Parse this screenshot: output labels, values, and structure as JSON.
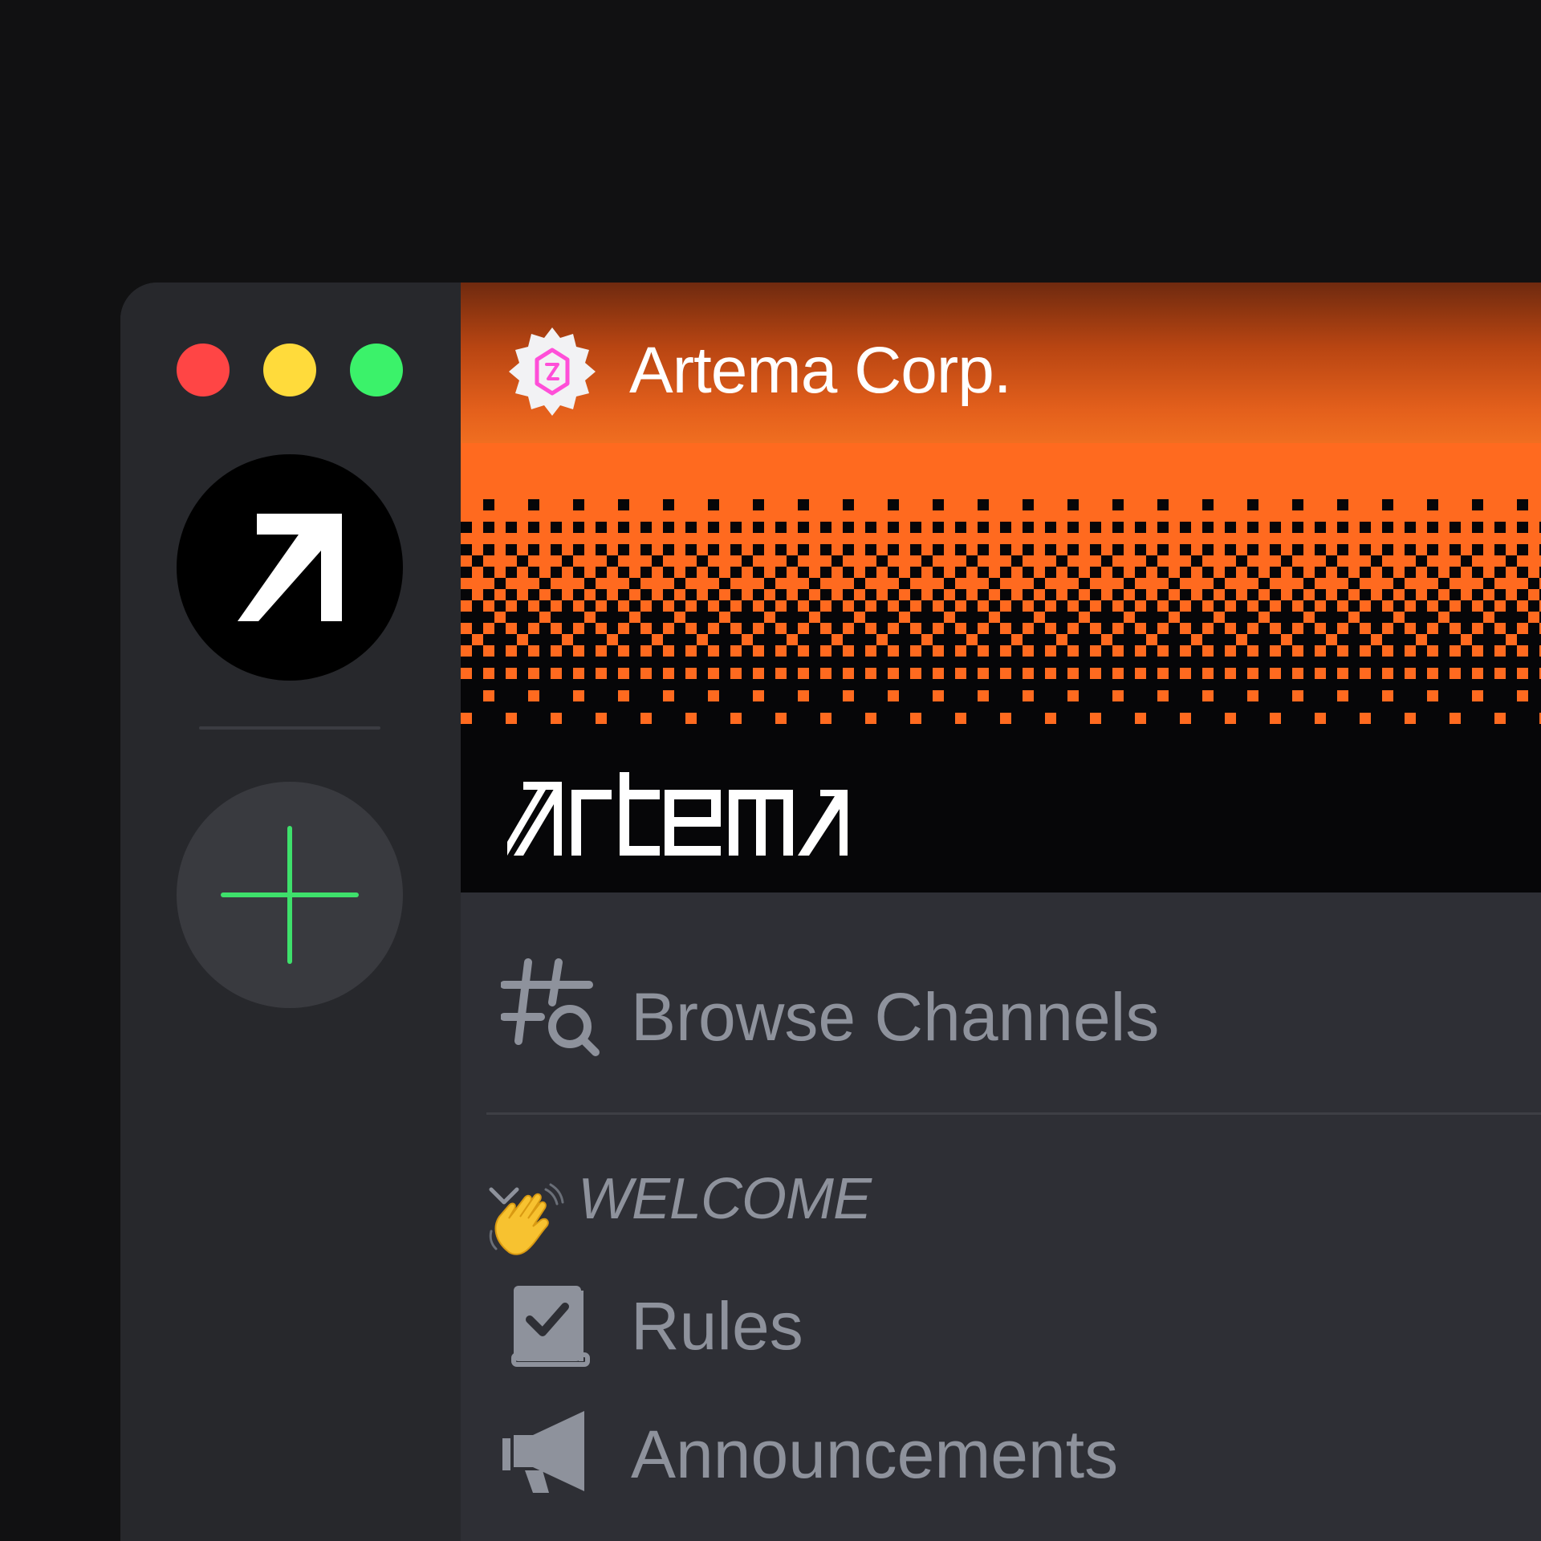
{
  "window_controls": {
    "close_color": "#ff4545",
    "minimize_color": "#ffdb3b",
    "zoom_color": "#3bf26a"
  },
  "server_rail": {
    "servers": [
      {
        "icon": "arrow-up-right-icon",
        "background": "#000000"
      }
    ],
    "add_server": {
      "icon": "plus-icon",
      "color": "#3ee06b"
    }
  },
  "server": {
    "name": "Artema Corp.",
    "badge_icon": "verified-badge-icon",
    "banner": {
      "wordmark": "artema",
      "accent_color": "#ff6a1f"
    }
  },
  "channels": {
    "browse_label": "Browse Channels",
    "browse_icon": "hash-search-icon",
    "categories": [
      {
        "name": "WELCOME",
        "emoji": "👋",
        "collapsed": false,
        "items": [
          {
            "label": "Rules",
            "icon": "rules-book-icon"
          },
          {
            "label": "Announcements",
            "icon": "megaphone-icon"
          }
        ]
      }
    ]
  }
}
